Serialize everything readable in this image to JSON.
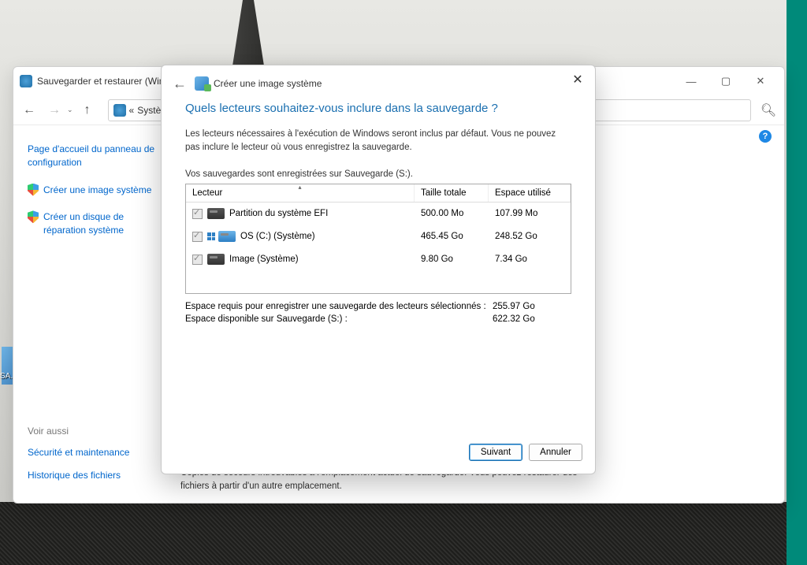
{
  "desktop": {
    "icon_label": "SA."
  },
  "parent_window": {
    "title": "Sauvegarder et restaurer (Windows 7)",
    "breadcrumb_prefix": "«",
    "breadcrumb_text": "Systè",
    "sidebar": {
      "home": "Page d'accueil du panneau de configuration",
      "create_image": "Créer une image système",
      "create_disc": "Créer un disque de réparation système",
      "see_also": "Voir aussi",
      "security": "Sécurité et maintenance",
      "history": "Historique des fichiers"
    },
    "backup_note": "Copies de secours introuvables à l'emplacement actuel de sauvegarde. Vous pouvez restaurer des fichiers à partir d'un autre emplacement."
  },
  "dialog": {
    "title": "Créer une image système",
    "heading": "Quels lecteurs souhaitez-vous inclure dans la sauvegarde ?",
    "description": "Les lecteurs nécessaires à l'exécution de Windows seront inclus par défaut. Vous ne pouvez pas inclure le lecteur où vous enregistrez la sauvegarde.",
    "save_note": "Vos sauvegardes sont enregistrées sur Sauvegarde (S:).",
    "columns": {
      "drive": "Lecteur",
      "total": "Taille totale",
      "used": "Espace utilisé"
    },
    "drives": [
      {
        "name": "Partition du système EFI",
        "total": "500.00 Mo",
        "used": "107.99 Mo",
        "checked": true,
        "type": "disk"
      },
      {
        "name": "OS (C:) (Système)",
        "total": "465.45 Go",
        "used": "248.52 Go",
        "checked": true,
        "type": "os"
      },
      {
        "name": "Image (Système)",
        "total": "9.80 Go",
        "used": "7.34 Go",
        "checked": true,
        "type": "disk"
      }
    ],
    "summary": {
      "required_label": "Espace requis pour enregistrer une sauvegarde des lecteurs sélectionnés :",
      "required_value": "255.97 Go",
      "available_label": "Espace disponible sur Sauvegarde (S:) :",
      "available_value": "622.32 Go"
    },
    "buttons": {
      "next": "Suivant",
      "cancel": "Annuler"
    }
  }
}
